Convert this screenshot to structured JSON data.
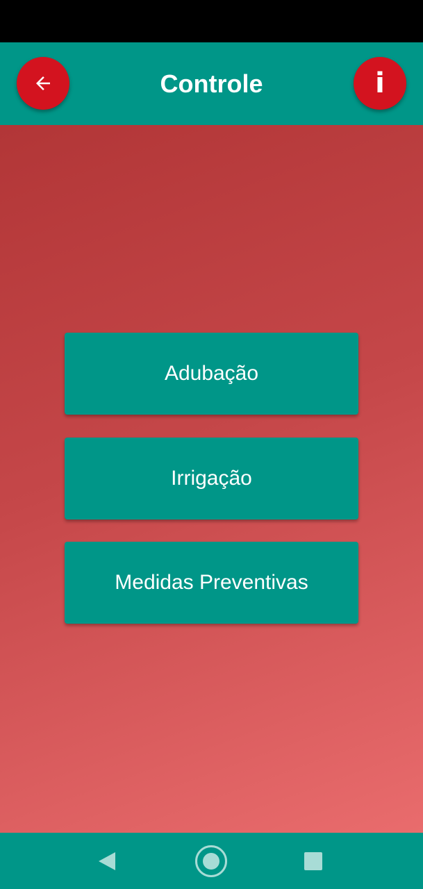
{
  "header": {
    "title": "Controle",
    "back_icon": "arrow-left-icon",
    "info_label": "i",
    "info_icon": "info-icon"
  },
  "menu": {
    "items": [
      {
        "label": "Adubação"
      },
      {
        "label": "Irrigação"
      },
      {
        "label": "Medidas Preventivas"
      }
    ]
  },
  "navigation": {
    "back_icon": "triangle-back-icon",
    "home_icon": "circle-home-icon",
    "recents_icon": "square-recents-icon"
  },
  "colors": {
    "primary": "#009688",
    "accent": "#d3131f",
    "background_start": "#b23637",
    "background_end": "#e96c6d"
  }
}
